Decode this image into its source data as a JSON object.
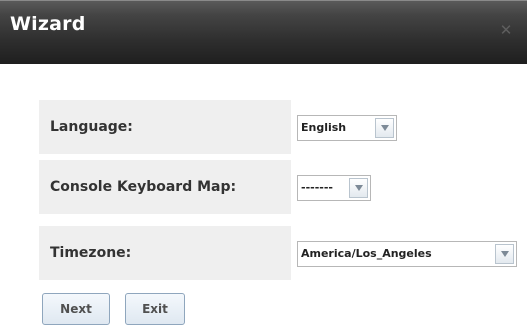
{
  "window": {
    "title": "Wizard",
    "close_icon": "close-icon"
  },
  "form": {
    "rows": [
      {
        "label": "Language:",
        "value": "English"
      },
      {
        "label": "Console Keyboard Map:",
        "value": "-------"
      },
      {
        "label": "Timezone:",
        "value": "America/Los_Angeles"
      }
    ]
  },
  "buttons": {
    "next": "Next",
    "exit": "Exit"
  },
  "colors": {
    "titlebar_dark": "#1e1e1e",
    "label_background": "#efefef",
    "button_border": "#8fa6bd"
  }
}
